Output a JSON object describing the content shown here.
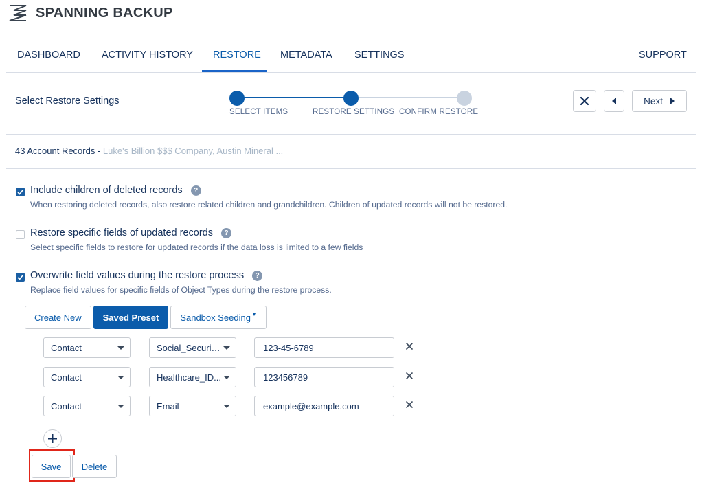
{
  "app": {
    "title": "SPANNING BACKUP",
    "logo_icon": "spanning-logo-icon"
  },
  "nav": {
    "items": [
      "DASHBOARD",
      "ACTIVITY HISTORY",
      "RESTORE",
      "METADATA",
      "SETTINGS"
    ],
    "support": "SUPPORT",
    "active": "RESTORE"
  },
  "wizard": {
    "title": "Select Restore Settings",
    "steps": [
      "SELECT ITEMS",
      "RESTORE SETTINGS",
      "CONFIRM RESTORE"
    ],
    "current_step": 2,
    "close_icon": "close-icon",
    "back_icon": "caret-left-icon",
    "next_label": "Next",
    "next_icon": "caret-right-icon"
  },
  "records": {
    "count_label": "43 Account Records -",
    "names": "Luke's Billion $$$ Company, Austin Mineral ..."
  },
  "options": [
    {
      "title": "Include children of deleted records",
      "desc": "When restoring deleted records, also restore related children and grandchildren. Children of updated records will not be restored.",
      "checked": true
    },
    {
      "title": "Restore specific fields of updated records",
      "desc": "Select specific fields to restore for updated records if the data loss is limited to a few fields",
      "checked": false
    },
    {
      "title": "Overwrite field values during the restore process",
      "desc": "Replace field values for specific fields of Object Types during the restore process.",
      "checked": true
    }
  ],
  "preset_tabs": [
    "Create New",
    "Saved Preset",
    "Sandbox Seeding"
  ],
  "active_tab": "Saved Preset",
  "field_rows": [
    {
      "object": "Contact",
      "field": "Social_Security...",
      "value": "123-45-6789"
    },
    {
      "object": "Contact",
      "field": "Healthcare_ID...",
      "value": "123456789"
    },
    {
      "object": "Contact",
      "field": "Email",
      "value": "example@example.com"
    }
  ],
  "actions": {
    "save": "Save",
    "delete": "Delete"
  },
  "colors": {
    "brand": "#0b5cab",
    "highlight": "#e0261a",
    "step_inactive": "#c9d3e0"
  }
}
